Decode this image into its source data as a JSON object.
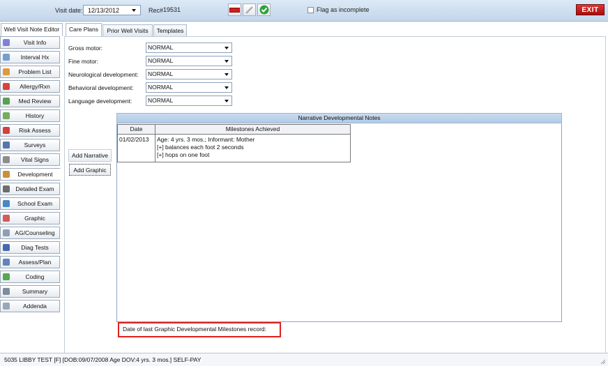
{
  "toolbar": {
    "visit_date_label": "Visit date:",
    "visit_date_value": "12/13/2012",
    "rec_label": "Rec#",
    "rec_value": "19531",
    "flag_label": "Flag as incomplete",
    "exit_label": "EXIT"
  },
  "tabs": {
    "editor": "Well Visit Note Editor",
    "care_plans": "Care Plans",
    "prior_well_visits": "Prior Well Visits",
    "templates": "Templates"
  },
  "sidebar": {
    "items": [
      {
        "label": "Visit Info",
        "icon": "visit-info-icon"
      },
      {
        "label": "Interval Hx",
        "icon": "interval-hx-icon"
      },
      {
        "label": "Problem List",
        "icon": "problem-list-icon"
      },
      {
        "label": "Allergy/Rxn",
        "icon": "allergy-icon"
      },
      {
        "label": "Med Review",
        "icon": "med-review-icon"
      },
      {
        "label": "History",
        "icon": "history-icon"
      },
      {
        "label": "Risk Assess",
        "icon": "risk-assess-icon"
      },
      {
        "label": "Surveys",
        "icon": "surveys-icon"
      },
      {
        "label": "Vital Signs",
        "icon": "vital-signs-icon"
      },
      {
        "label": "Development",
        "icon": "development-icon"
      },
      {
        "label": "Detailed Exam",
        "icon": "stethoscope-icon"
      },
      {
        "label": "School Exam",
        "icon": "school-exam-icon"
      },
      {
        "label": "Graphic",
        "icon": "graphic-icon"
      },
      {
        "label": "AG/Counseling",
        "icon": "counseling-icon"
      },
      {
        "label": "Diag Tests",
        "icon": "test-tubes-icon"
      },
      {
        "label": "Assess/Plan",
        "icon": "assess-plan-icon"
      },
      {
        "label": "Coding",
        "icon": "coding-icon"
      },
      {
        "label": "Summary",
        "icon": "summary-icon"
      },
      {
        "label": "Addenda",
        "icon": "addenda-icon"
      }
    ]
  },
  "development": {
    "fields": [
      {
        "label": "Gross motor:",
        "value": "NORMAL"
      },
      {
        "label": "Fine motor:",
        "value": "NORMAL"
      },
      {
        "label": "Neurological development:",
        "value": "NORMAL"
      },
      {
        "label": "Behavioral development:",
        "value": "NORMAL"
      },
      {
        "label": "Language development:",
        "value": "NORMAL"
      }
    ],
    "narrative_header": "Narrative Developmental Notes",
    "table": {
      "col_date": "Date",
      "col_milestones": "Milestones Achieved",
      "rows": [
        {
          "date": "01/02/2013",
          "line1": "Age: 4 yrs. 3 mos.; Informant: Mother",
          "line2": "[+] balances each foot 2 seconds",
          "line3": "[+] hops on one foot"
        }
      ]
    },
    "add_narrative_label": "Add Narrative",
    "add_graphic_label": "Add Graphic",
    "last_record_label": "Date of last Graphic Developmental Milestones record:"
  },
  "status": {
    "text": "5035 LIBBY TEST  [F]  [DOB:09/07/2008  Age DOV:4 yrs. 3 mos.]  SELF-PAY"
  }
}
